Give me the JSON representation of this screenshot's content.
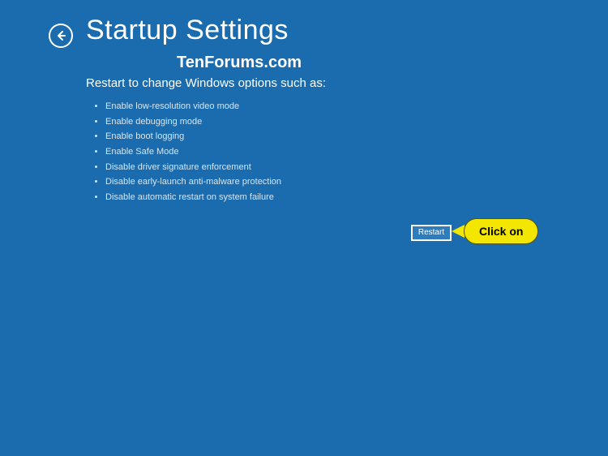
{
  "header": {
    "title": "Startup Settings"
  },
  "watermark": "TenForums.com",
  "subtitle": "Restart to change Windows options such as:",
  "options": [
    "Enable low-resolution video mode",
    "Enable debugging mode",
    "Enable boot logging",
    "Enable Safe Mode",
    "Disable driver signature enforcement",
    "Disable early-launch anti-malware protection",
    "Disable automatic restart on system failure"
  ],
  "actions": {
    "restart_label": "Restart"
  },
  "annotation": {
    "callout_text": "Click on"
  }
}
